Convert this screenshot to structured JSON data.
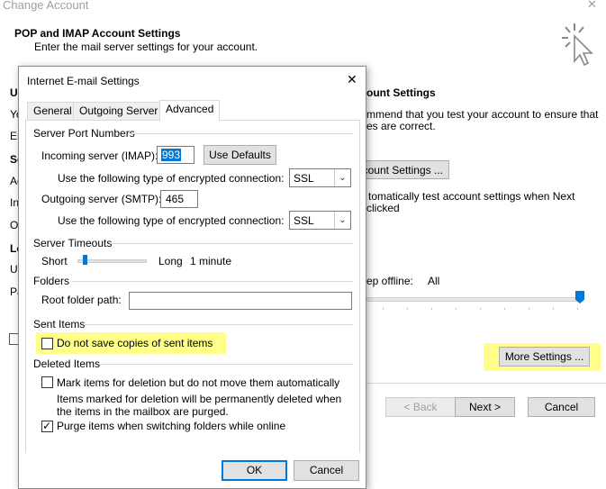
{
  "parent": {
    "title": "Change Account",
    "heading": "POP and IMAP Account Settings",
    "subheading": "Enter the mail server settings for your account.",
    "behind_text": {
      "test_heading": "ount Settings",
      "test_desc_1": "mmend that you test your account to ensure that",
      "test_desc_2": "es are correct.",
      "test_button": "count Settings ...",
      "auto_test_1": "tomatically test account settings when Next",
      "auto_test_2": "clicked",
      "offline_label": "ep offline:",
      "offline_value": "All",
      "left_letters": [
        "Us",
        "Yo",
        "Em",
        "Se",
        "Ac",
        "In",
        "Ou",
        "Lo",
        "Us",
        "Pa"
      ]
    },
    "more_settings_label": "More Settings ...",
    "back_label": "< Back",
    "next_label": "Next >",
    "cancel_label": "Cancel",
    "close_glyph": "✕"
  },
  "dialog": {
    "title": "Internet E-mail Settings",
    "close_glyph": "✕",
    "tabs": [
      {
        "label": "General",
        "active": false
      },
      {
        "label": "Outgoing Server",
        "active": false
      },
      {
        "label": "Advanced",
        "active": true
      }
    ],
    "server_ports": {
      "section": "Server Port Numbers",
      "incoming_label": "Incoming server (IMAP):",
      "incoming_value": "993",
      "use_defaults": "Use Defaults",
      "encryption_label_in": "Use the following type of encrypted connection:",
      "encryption_value_in": "SSL",
      "outgoing_label": "Outgoing server (SMTP):",
      "outgoing_value": "465",
      "encryption_label_out": "Use the following type of encrypted connection:",
      "encryption_value_out": "SSL"
    },
    "timeouts": {
      "section": "Server Timeouts",
      "short": "Short",
      "long": "Long",
      "value": "1 minute",
      "level": 0.1
    },
    "folders": {
      "section": "Folders",
      "root_label": "Root folder path:",
      "root_value": ""
    },
    "sent_items": {
      "section": "Sent Items",
      "do_not_save_label": "Do not save copies of sent items",
      "do_not_save_checked": false
    },
    "deleted_items": {
      "section": "Deleted Items",
      "mark_label": "Mark items for deletion but do not move them automatically",
      "mark_checked": false,
      "note_1": "Items marked for deletion will be permanently deleted when",
      "note_2": "the items in the mailbox are purged.",
      "purge_label": "Purge items when switching folders while online",
      "purge_checked": true
    },
    "ok_label": "OK",
    "cancel_label": "Cancel"
  },
  "colors": {
    "highlight": "#ffff8a",
    "accent": "#0078d7",
    "selection": "#0078d7"
  }
}
